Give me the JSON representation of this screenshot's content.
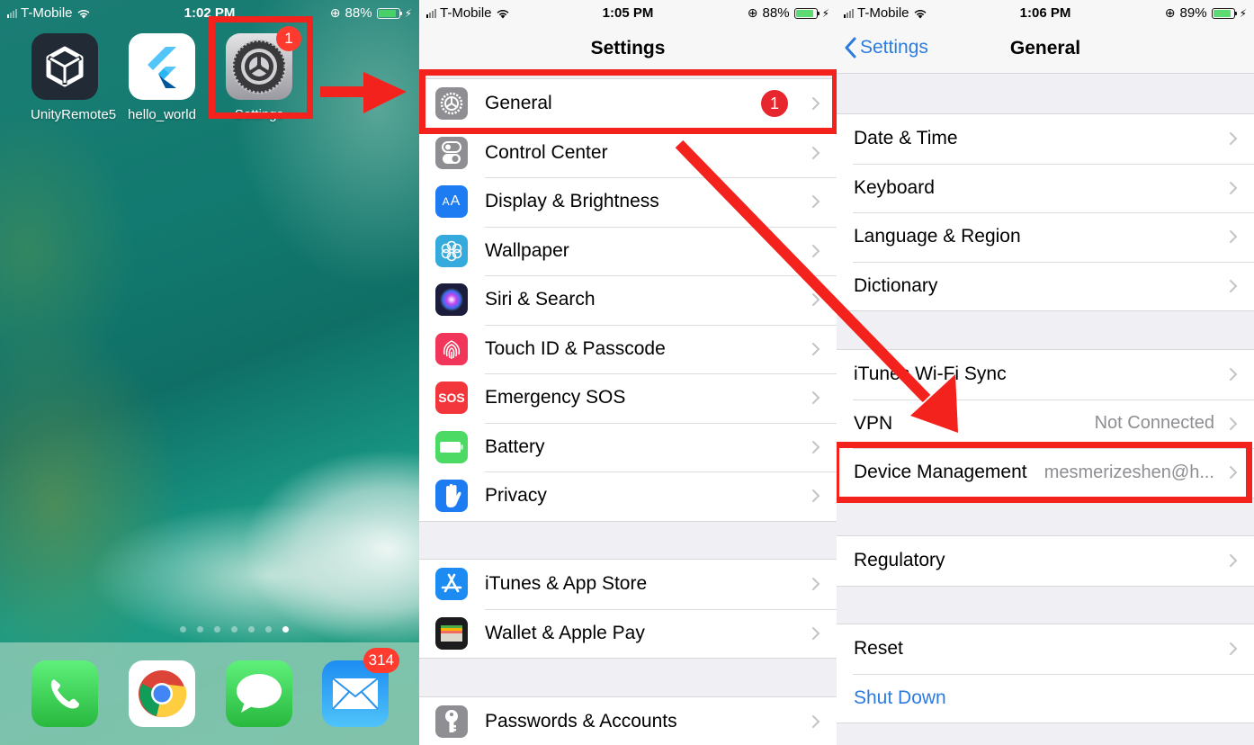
{
  "home": {
    "status": {
      "carrier": "T-Mobile",
      "time": "1:02 PM",
      "battery": "88%",
      "battery_level": 0.88
    },
    "apps": [
      {
        "name": "unity-remote",
        "label": "UnityRemote5"
      },
      {
        "name": "hello-world",
        "label": "hello_world"
      },
      {
        "name": "settings",
        "label": "Settings",
        "badge": "1"
      }
    ],
    "page_dots": {
      "count": 7,
      "active_index": 6
    },
    "dock": [
      {
        "name": "phone",
        "badge": null
      },
      {
        "name": "chrome",
        "badge": null
      },
      {
        "name": "messages",
        "badge": null
      },
      {
        "name": "mail",
        "badge": "314"
      }
    ]
  },
  "settings": {
    "status": {
      "carrier": "T-Mobile",
      "time": "1:05 PM",
      "battery": "88%",
      "battery_level": 0.88
    },
    "title": "Settings",
    "groups": [
      [
        {
          "label": "General",
          "icon": "gear-icon",
          "color": "#8e8e93",
          "badge": "1"
        },
        {
          "label": "Control Center",
          "icon": "toggles-icon",
          "color": "#8e8e93"
        },
        {
          "label": "Display & Brightness",
          "icon": "text-size-icon",
          "color": "#1d7cf2"
        },
        {
          "label": "Wallpaper",
          "icon": "flower-icon",
          "color": "#35aadc"
        },
        {
          "label": "Siri & Search",
          "icon": "siri-icon",
          "color": "#1c1c3c"
        },
        {
          "label": "Touch ID & Passcode",
          "icon": "fingerprint-icon",
          "color": "#f2355a"
        },
        {
          "label": "Emergency SOS",
          "icon": "sos-icon",
          "color": "#f2363b",
          "icon_text": "SOS"
        },
        {
          "label": "Battery",
          "icon": "battery-icon",
          "color": "#4cd964"
        },
        {
          "label": "Privacy",
          "icon": "hand-icon",
          "color": "#1d7cf2"
        }
      ],
      [
        {
          "label": "iTunes & App Store",
          "icon": "app-store-icon",
          "color": "#1d8cf2"
        },
        {
          "label": "Wallet & Apple Pay",
          "icon": "wallet-icon",
          "color": "#1c1c1e"
        }
      ],
      [
        {
          "label": "Passwords & Accounts",
          "icon": "key-icon",
          "color": "#8e8e93"
        }
      ]
    ]
  },
  "general": {
    "status": {
      "carrier": "T-Mobile",
      "time": "1:06 PM",
      "battery": "89%",
      "battery_level": 0.89
    },
    "back_label": "Settings",
    "title": "General",
    "groups": [
      [
        {
          "label": "Date & Time"
        },
        {
          "label": "Keyboard"
        },
        {
          "label": "Language & Region"
        },
        {
          "label": "Dictionary"
        }
      ],
      [
        {
          "label": "iTunes Wi-Fi Sync"
        },
        {
          "label": "VPN",
          "value": "Not Connected"
        },
        {
          "label": "Device Management",
          "value": "mesmerizeshen@h..."
        }
      ],
      [
        {
          "label": "Regulatory"
        }
      ],
      [
        {
          "label": "Reset"
        },
        {
          "label": "Shut Down",
          "link": true,
          "no_chevron": true
        }
      ]
    ]
  },
  "colors": {
    "annotation": "#f4221d",
    "ios_blue": "#2c7ce0",
    "badge_red": "#ff3b30"
  }
}
